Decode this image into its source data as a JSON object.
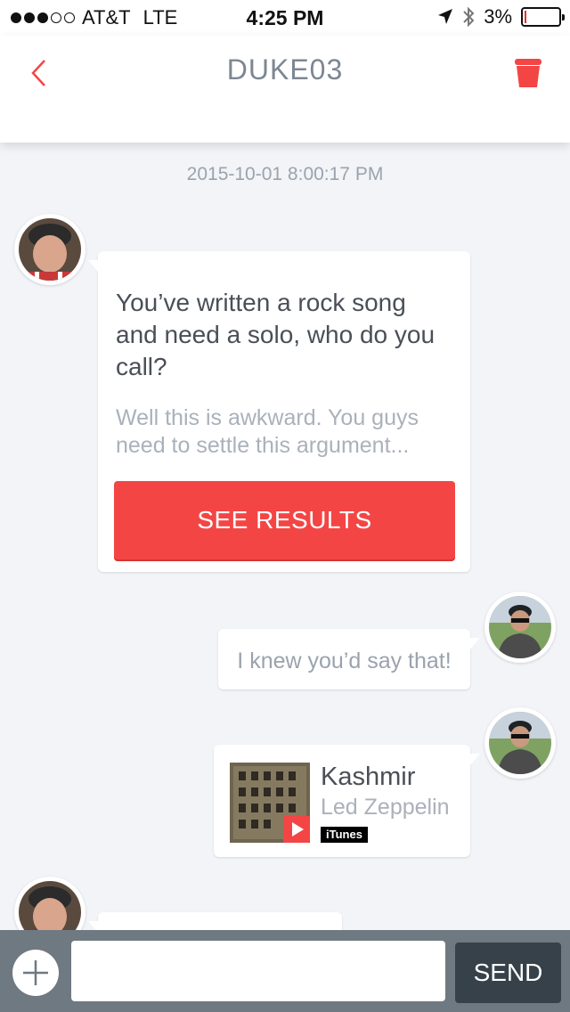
{
  "status_bar": {
    "carrier": "AT&T",
    "network": "LTE",
    "time": "4:25 PM",
    "battery": "3%",
    "battery_level": 0.03,
    "signal_bars_filled": 3,
    "signal_bars_total": 5
  },
  "nav": {
    "title": "DUKE03",
    "back_icon": "chevron-left-icon",
    "trash_icon": "trash-icon"
  },
  "chat": {
    "timestamp": "2015-10-01 8:00:17 PM",
    "question_card": {
      "question": "You’ve written a rock song and need a solo, who do you call?",
      "answer": "Well this is awkward. You guys need to settle this argument...",
      "button_label": "SEE RESULTS"
    },
    "reply": {
      "text": "I knew you’d say that!"
    },
    "song_card": {
      "title": "Kashmir",
      "artist": "Led Zeppelin",
      "badge": "iTunes",
      "play_icon": "play-icon"
    }
  },
  "input_bar": {
    "add_icon": "plus-icon",
    "placeholder": "",
    "send_label": "SEND"
  },
  "colors": {
    "accent": "#f44545",
    "background": "#f2f4f8",
    "send_button": "#37414a",
    "input_bar": "#6f7982"
  }
}
